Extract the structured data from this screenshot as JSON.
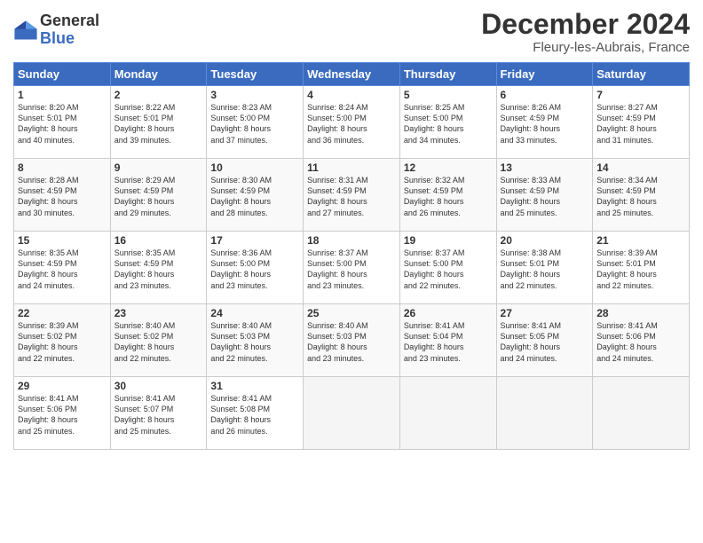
{
  "logo": {
    "name": "General",
    "name2": "Blue"
  },
  "title": "December 2024",
  "location": "Fleury-les-Aubrais, France",
  "days_of_week": [
    "Sunday",
    "Monday",
    "Tuesday",
    "Wednesday",
    "Thursday",
    "Friday",
    "Saturday"
  ],
  "weeks": [
    [
      {
        "day": "1",
        "info": "Sunrise: 8:20 AM\nSunset: 5:01 PM\nDaylight: 8 hours\nand 40 minutes."
      },
      {
        "day": "2",
        "info": "Sunrise: 8:22 AM\nSunset: 5:01 PM\nDaylight: 8 hours\nand 39 minutes."
      },
      {
        "day": "3",
        "info": "Sunrise: 8:23 AM\nSunset: 5:00 PM\nDaylight: 8 hours\nand 37 minutes."
      },
      {
        "day": "4",
        "info": "Sunrise: 8:24 AM\nSunset: 5:00 PM\nDaylight: 8 hours\nand 36 minutes."
      },
      {
        "day": "5",
        "info": "Sunrise: 8:25 AM\nSunset: 5:00 PM\nDaylight: 8 hours\nand 34 minutes."
      },
      {
        "day": "6",
        "info": "Sunrise: 8:26 AM\nSunset: 4:59 PM\nDaylight: 8 hours\nand 33 minutes."
      },
      {
        "day": "7",
        "info": "Sunrise: 8:27 AM\nSunset: 4:59 PM\nDaylight: 8 hours\nand 31 minutes."
      }
    ],
    [
      {
        "day": "8",
        "info": "Sunrise: 8:28 AM\nSunset: 4:59 PM\nDaylight: 8 hours\nand 30 minutes."
      },
      {
        "day": "9",
        "info": "Sunrise: 8:29 AM\nSunset: 4:59 PM\nDaylight: 8 hours\nand 29 minutes."
      },
      {
        "day": "10",
        "info": "Sunrise: 8:30 AM\nSunset: 4:59 PM\nDaylight: 8 hours\nand 28 minutes."
      },
      {
        "day": "11",
        "info": "Sunrise: 8:31 AM\nSunset: 4:59 PM\nDaylight: 8 hours\nand 27 minutes."
      },
      {
        "day": "12",
        "info": "Sunrise: 8:32 AM\nSunset: 4:59 PM\nDaylight: 8 hours\nand 26 minutes."
      },
      {
        "day": "13",
        "info": "Sunrise: 8:33 AM\nSunset: 4:59 PM\nDaylight: 8 hours\nand 25 minutes."
      },
      {
        "day": "14",
        "info": "Sunrise: 8:34 AM\nSunset: 4:59 PM\nDaylight: 8 hours\nand 25 minutes."
      }
    ],
    [
      {
        "day": "15",
        "info": "Sunrise: 8:35 AM\nSunset: 4:59 PM\nDaylight: 8 hours\nand 24 minutes."
      },
      {
        "day": "16",
        "info": "Sunrise: 8:35 AM\nSunset: 4:59 PM\nDaylight: 8 hours\nand 23 minutes."
      },
      {
        "day": "17",
        "info": "Sunrise: 8:36 AM\nSunset: 5:00 PM\nDaylight: 8 hours\nand 23 minutes."
      },
      {
        "day": "18",
        "info": "Sunrise: 8:37 AM\nSunset: 5:00 PM\nDaylight: 8 hours\nand 23 minutes."
      },
      {
        "day": "19",
        "info": "Sunrise: 8:37 AM\nSunset: 5:00 PM\nDaylight: 8 hours\nand 22 minutes."
      },
      {
        "day": "20",
        "info": "Sunrise: 8:38 AM\nSunset: 5:01 PM\nDaylight: 8 hours\nand 22 minutes."
      },
      {
        "day": "21",
        "info": "Sunrise: 8:39 AM\nSunset: 5:01 PM\nDaylight: 8 hours\nand 22 minutes."
      }
    ],
    [
      {
        "day": "22",
        "info": "Sunrise: 8:39 AM\nSunset: 5:02 PM\nDaylight: 8 hours\nand 22 minutes."
      },
      {
        "day": "23",
        "info": "Sunrise: 8:40 AM\nSunset: 5:02 PM\nDaylight: 8 hours\nand 22 minutes."
      },
      {
        "day": "24",
        "info": "Sunrise: 8:40 AM\nSunset: 5:03 PM\nDaylight: 8 hours\nand 22 minutes."
      },
      {
        "day": "25",
        "info": "Sunrise: 8:40 AM\nSunset: 5:03 PM\nDaylight: 8 hours\nand 23 minutes."
      },
      {
        "day": "26",
        "info": "Sunrise: 8:41 AM\nSunset: 5:04 PM\nDaylight: 8 hours\nand 23 minutes."
      },
      {
        "day": "27",
        "info": "Sunrise: 8:41 AM\nSunset: 5:05 PM\nDaylight: 8 hours\nand 24 minutes."
      },
      {
        "day": "28",
        "info": "Sunrise: 8:41 AM\nSunset: 5:06 PM\nDaylight: 8 hours\nand 24 minutes."
      }
    ],
    [
      {
        "day": "29",
        "info": "Sunrise: 8:41 AM\nSunset: 5:06 PM\nDaylight: 8 hours\nand 25 minutes."
      },
      {
        "day": "30",
        "info": "Sunrise: 8:41 AM\nSunset: 5:07 PM\nDaylight: 8 hours\nand 25 minutes."
      },
      {
        "day": "31",
        "info": "Sunrise: 8:41 AM\nSunset: 5:08 PM\nDaylight: 8 hours\nand 26 minutes."
      },
      null,
      null,
      null,
      null
    ]
  ]
}
